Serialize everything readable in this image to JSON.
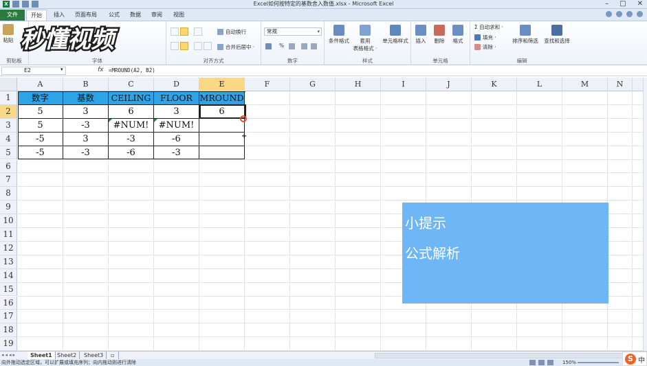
{
  "window": {
    "title": "Excel如何按特定的基数舍入数值.xlsx - Microsoft Excel",
    "controls": [
      "–",
      "□",
      "✕"
    ]
  },
  "tabs": {
    "file": "文件",
    "items": [
      "开始",
      "插入",
      "页面布局",
      "公式",
      "数据",
      "审阅",
      "视图"
    ],
    "active": "开始"
  },
  "ribbon": {
    "clipboard": {
      "paste": "粘贴",
      "label": "剪贴板"
    },
    "font": {
      "label": "字体"
    },
    "alignment": {
      "wrap": "自动换行",
      "merge": "合并后居中 ·",
      "label": "对齐方式"
    },
    "number": {
      "format": "常规",
      "percent": "%",
      "label": "数字"
    },
    "styles": {
      "conditional": "条件格式",
      "table_line1": "套用",
      "table_line2": "表格格式 ·",
      "cell_styles": "单元格样式",
      "label": "样式"
    },
    "cells": {
      "insert": "插入",
      "delete": "删除",
      "format": "格式",
      "label": "单元格"
    },
    "editing": {
      "autosum": "Σ 自动求和 ·",
      "fill": "填充 ·",
      "clear": "清除 ·",
      "sort": "排序和筛选",
      "find": "查找和选择",
      "label": "编辑"
    }
  },
  "watermark": {
    "text": "秒懂视频"
  },
  "formula_bar": {
    "name_box": "E2",
    "fx": "fx",
    "formula": "=MROUND(A2, B2)"
  },
  "columns": [
    "A",
    "B",
    "C",
    "D",
    "E",
    "F",
    "G",
    "H",
    "I",
    "J",
    "K",
    "L",
    "M",
    "N"
  ],
  "selected_column": "E",
  "rows": [
    "1",
    "2",
    "3",
    "4",
    "5",
    "6",
    "7",
    "8",
    "9",
    "10",
    "11",
    "12",
    "13",
    "14",
    "15",
    "16",
    "17",
    "18",
    "19"
  ],
  "selected_row": "2",
  "table": {
    "headers": [
      "数字",
      "基数",
      "CEILING",
      "FLOOR",
      "MROUND"
    ],
    "rows": [
      [
        "5",
        "3",
        "6",
        "3",
        "6"
      ],
      [
        "5",
        "-3",
        "#NUM!",
        "#NUM!",
        ""
      ],
      [
        "-5",
        "3",
        "-3",
        "-6",
        ""
      ],
      [
        "-5",
        "-3",
        "-6",
        "-3",
        ""
      ]
    ]
  },
  "tip": {
    "title": "小提示",
    "subtitle": "公式解析"
  },
  "sheets": [
    "Sheet1",
    "Sheet2",
    "Sheet3"
  ],
  "active_sheet": "Sheet1",
  "status": {
    "message": "向外拖动选定区域，可以扩展或填充序列；向内拖动则进行清除",
    "zoom": "150%"
  },
  "ime": {
    "logo": "S",
    "mode": "中"
  },
  "colors": {
    "header_fill": "#2ea3e8",
    "tip_fill": "#6eb6f6",
    "selected_header": "#f9d985"
  }
}
